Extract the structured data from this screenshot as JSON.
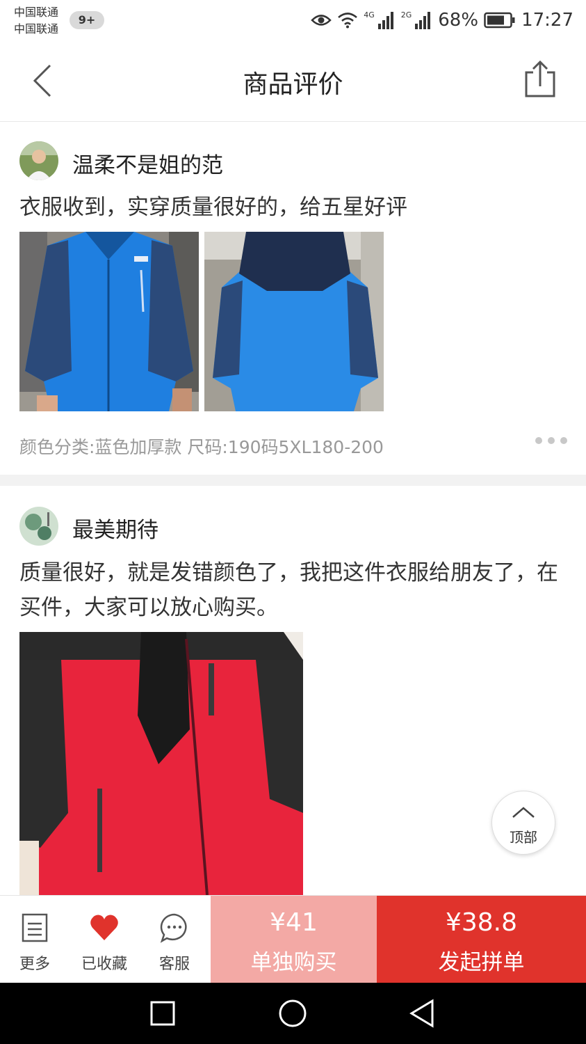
{
  "status_bar": {
    "carrier_1": "中国联通",
    "carrier_2": "中国联通",
    "notification_badge": "9+",
    "net_1": "4G",
    "net_2": "2G",
    "battery": "68%",
    "time": "17:27"
  },
  "header": {
    "title": "商品评价"
  },
  "reviews": [
    {
      "username": "温柔不是姐的范",
      "text": "衣服收到，实穿质量很好的，给五星好评",
      "spec": "颜色分类:蓝色加厚款  尺码:190码5XL180-200"
    },
    {
      "username": "最美期待",
      "text": "质量很好，就是发错颜色了，我把这件衣服给朋友了，在买件，大家可以放心购买。"
    }
  ],
  "back_to_top": {
    "label": "顶部"
  },
  "bottom_bar": {
    "more_label": "更多",
    "favorite_label": "已收藏",
    "service_label": "客服",
    "single_price": "¥41",
    "single_label": "单独购买",
    "group_price": "¥38.8",
    "group_label": "发起拼单"
  },
  "colors": {
    "accent_red": "#e0332c",
    "light_red": "#f3a9a5",
    "jacket_blue": "#1f7fe0",
    "jacket_red": "#e8243c"
  }
}
